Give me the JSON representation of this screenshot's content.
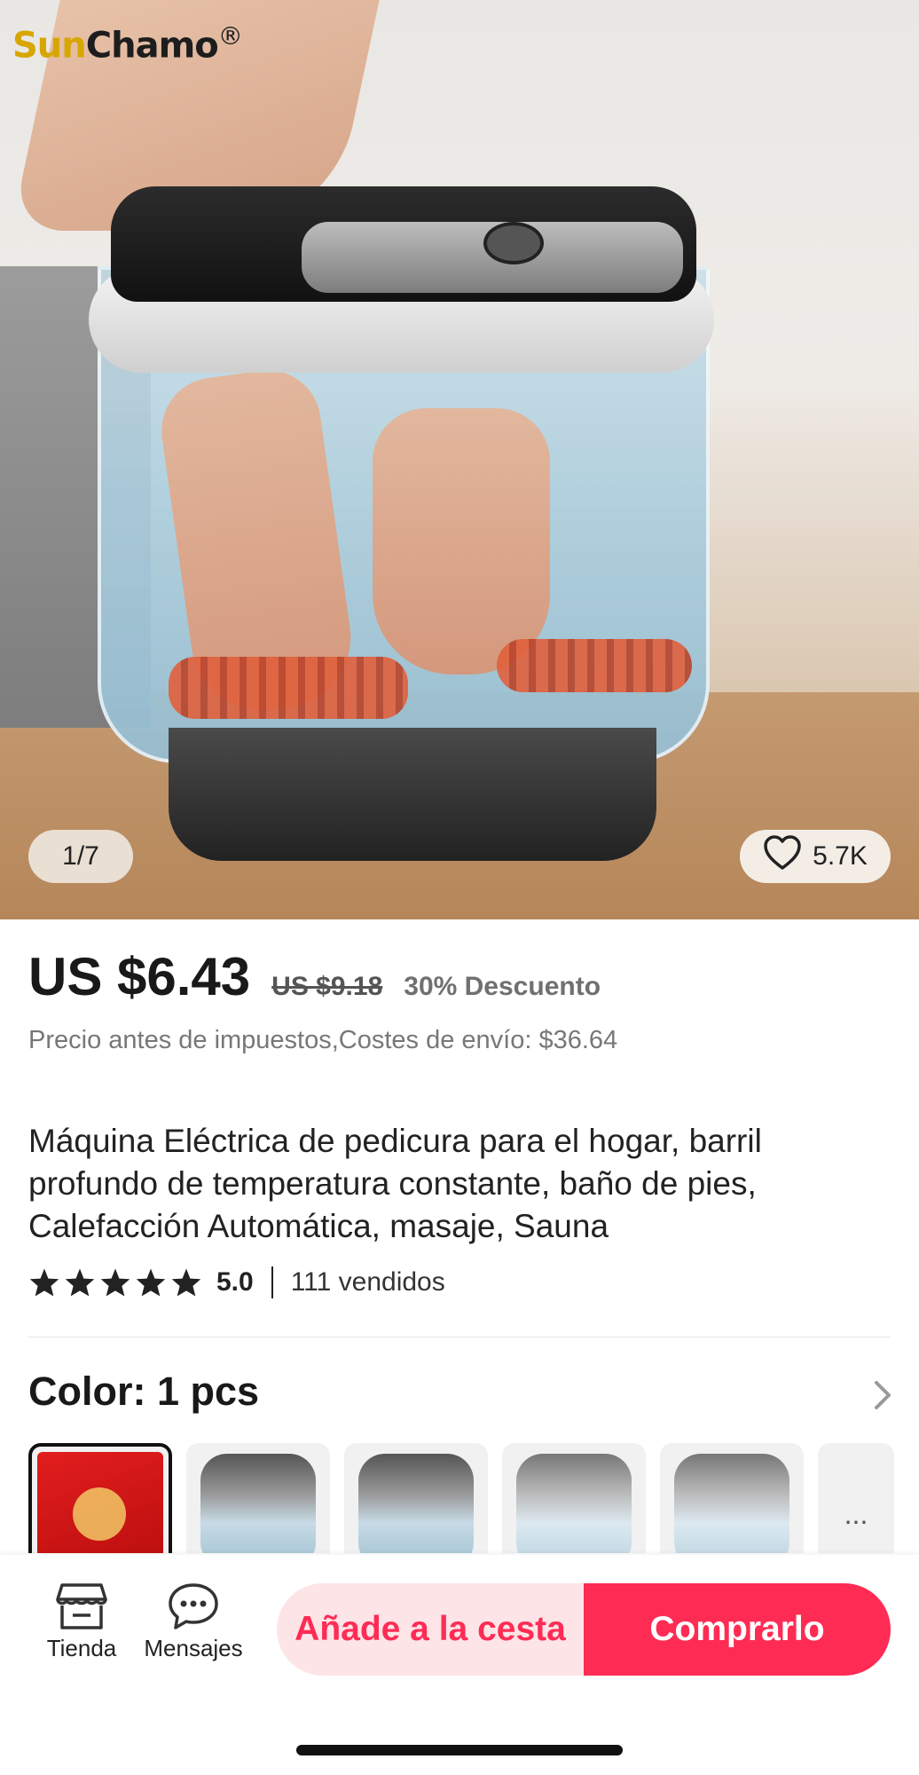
{
  "brand": {
    "prefix": "Sun",
    "name": "Chamo",
    "mark": "®"
  },
  "gallery": {
    "pager": "1/7",
    "likes": "5.7K"
  },
  "pricing": {
    "price": "US $6.43",
    "original_price": "US $9.18",
    "discount": "30% Descuento",
    "tax_note": "Precio antes de impuestos,Costes de envío: $36.64"
  },
  "product": {
    "title": "Máquina Eléctrica de pedicura para el hogar, barril profundo de temperatura constante, baño de pies, Calefacción Automática, masaje, Sauna",
    "rating": "5.0",
    "stars": 5,
    "sold": "111 vendidos"
  },
  "variant": {
    "label": "Color: 1 pcs",
    "more": "..."
  },
  "bottom_bar": {
    "store_label": "Tienda",
    "messages_label": "Mensajes",
    "add_to_cart": "Añade a la cesta",
    "buy_now": "Comprarlo"
  },
  "colors": {
    "accent": "#fe2c55",
    "accent_light": "#fde4e7"
  }
}
